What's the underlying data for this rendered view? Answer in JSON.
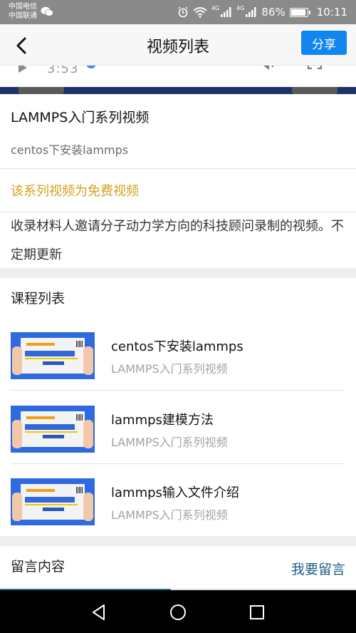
{
  "status_bar": {
    "carrier_1": "中国电信",
    "carrier_2": "中国联通",
    "network_1": "4G",
    "network_2": "4G",
    "battery_percent": "86%",
    "battery_level": 0.86,
    "time": "10:11",
    "icons": [
      "wechat-icon",
      "alarm-icon",
      "wifi-icon",
      "signal-icon",
      "battery-icon"
    ]
  },
  "header": {
    "title": "视频列表",
    "share_label": "分享",
    "share_color": "#1185f0"
  },
  "player": {
    "time": "3:53"
  },
  "series": {
    "title": "LAMMPS入门系列视频",
    "current_video": "centos下安装lammps",
    "free_notice": "该系列视频为免费视频",
    "free_color": "#d3a11c",
    "description": "收录材料人邀请分子动力学方向的科技顾问录制的视频。不定期更新"
  },
  "course_list": {
    "heading": "课程列表",
    "items": [
      {
        "title": "centos下安装lammps",
        "subtitle": "LAMMPS入门系列视频"
      },
      {
        "title": "lammps建模方法",
        "subtitle": "LAMMPS入门系列视频"
      },
      {
        "title": "lammps输入文件介绍",
        "subtitle": "LAMMPS入门系列视频"
      }
    ]
  },
  "comments": {
    "label": "留言内容",
    "action_label": "我要留言",
    "action_color": "#1d5c86",
    "progress": 0.48
  },
  "nav": {
    "icons": [
      "back-triangle-icon",
      "home-circle-icon",
      "recents-square-icon"
    ]
  }
}
